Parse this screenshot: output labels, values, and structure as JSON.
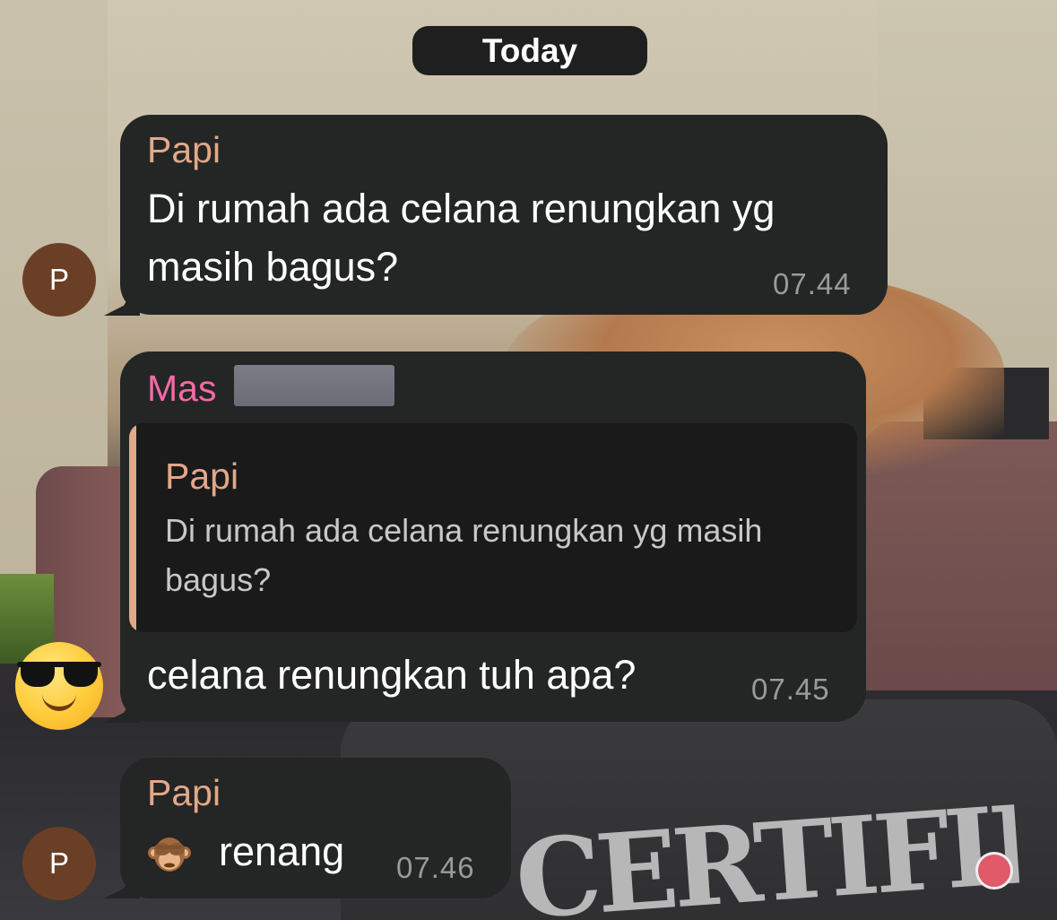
{
  "date_pill": "Today",
  "colors": {
    "bubble_bg": "#242525",
    "papi_name": "#e2a888",
    "mas_name": "#f26ba5",
    "timestamp": "#9a9a9a",
    "avatar_bg": "#6b3f26"
  },
  "messages": [
    {
      "sender": "Papi",
      "avatar_letter": "P",
      "line1": "Di rumah ada celana renungkan yg",
      "line2": "masih bagus?",
      "time": "07.44"
    },
    {
      "sender": "Mas",
      "avatar_icon": "smiling-face-with-sunglasses-icon",
      "reply_to": {
        "sender": "Papi",
        "line1": "Di rumah ada celana renungkan yg masih",
        "line2": "bagus?"
      },
      "text": "celana renungkan tuh apa?",
      "time": "07.45"
    },
    {
      "sender": "Papi",
      "avatar_letter": "P",
      "emoji_icon": "see-no-evil-monkey-icon",
      "text": "renang",
      "time": "07.46"
    }
  ],
  "wallpaper": {
    "shirt_text": "CERTIFIED"
  }
}
